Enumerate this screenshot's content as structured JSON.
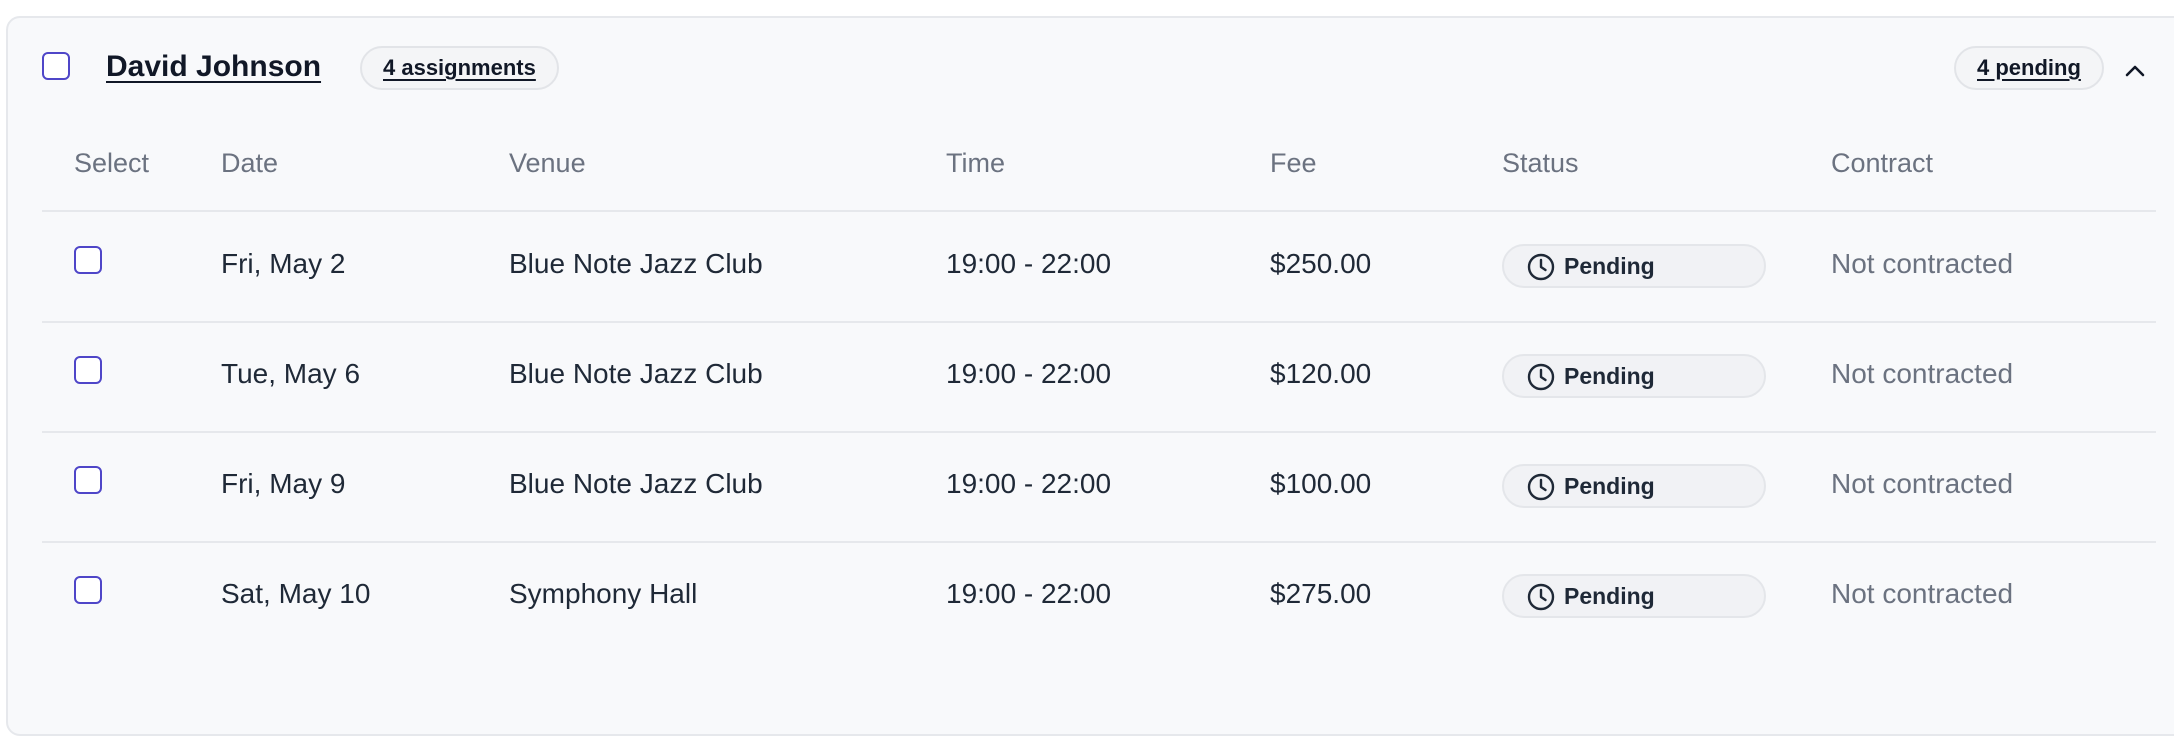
{
  "group": {
    "name": "David Johnson",
    "assignments_badge": "4 assignments",
    "pending_badge": "4 pending",
    "collapse_icon": "chevron-up-icon"
  },
  "table": {
    "columns": [
      "Select",
      "Date",
      "Venue",
      "Time",
      "Fee",
      "Status",
      "Contract"
    ],
    "rows": [
      {
        "date": "Fri, May 2",
        "venue": "Blue Note Jazz Club",
        "time": "19:00 - 22:00",
        "fee": "$250.00",
        "status": "Pending",
        "contract": "Not contracted"
      },
      {
        "date": "Tue, May 6",
        "venue": "Blue Note Jazz Club",
        "time": "19:00 - 22:00",
        "fee": "$120.00",
        "status": "Pending",
        "contract": "Not contracted"
      },
      {
        "date": "Fri, May 9",
        "venue": "Blue Note Jazz Club",
        "time": "19:00 - 22:00",
        "fee": "$100.00",
        "status": "Pending",
        "contract": "Not contracted"
      },
      {
        "date": "Sat, May 10",
        "venue": "Symphony Hall",
        "time": "19:00 - 22:00",
        "fee": "$275.00",
        "status": "Pending",
        "contract": "Not contracted"
      }
    ],
    "status_icon": "clock-icon"
  },
  "colors": {
    "checkbox_border": "#4f46c8",
    "card_background": "#f8f9fb",
    "muted_text": "#6b7280"
  }
}
